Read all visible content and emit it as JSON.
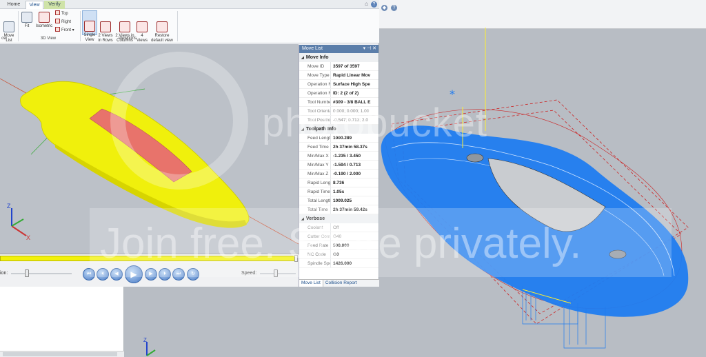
{
  "ribbon": {
    "tabs": [
      "Home",
      "View",
      "Verify"
    ],
    "buttons": {
      "move_list": "Move\nList",
      "fit": "Fit",
      "isometric": "Isometric",
      "top": "Top",
      "right": "Right",
      "front": "Front",
      "single_view": "Single\nView",
      "two_rows": "2 Views\nin Rows",
      "two_cols": "2 Views in\nColumns",
      "four_views": "4\nViews",
      "restore": "Restore\ndefault view"
    },
    "groups": {
      "left": "ow",
      "view3d": "3D View",
      "viewports": "Viewports"
    }
  },
  "move_list": {
    "title": "Move List",
    "sections": [
      {
        "name": "Move Info",
        "rows": [
          {
            "key": "Move ID",
            "value": "3597 of 3597"
          },
          {
            "key": "Move Type",
            "value": "Rapid Linear Mov"
          },
          {
            "key": "Operation Nar",
            "value": "Surface High Spe"
          },
          {
            "key": "Operation Nu",
            "value": "ID: 2 (2 of 2)"
          },
          {
            "key": "Tool Number",
            "value": "#309 - 3/8 BALL E"
          },
          {
            "key": "Tool Orientati",
            "value": "0.000; 0.000; 1.00"
          },
          {
            "key": "Tool Position",
            "value": "-0.547; 0.713; 2.0"
          }
        ]
      },
      {
        "name": "Toolpath Info",
        "rows": [
          {
            "key": "Feed Length",
            "value": "1000.289"
          },
          {
            "key": "Feed Time",
            "value": "2h 37min 58.37s"
          },
          {
            "key": "Min/Max X",
            "value": "-1.235 / 3.450"
          },
          {
            "key": "Min/Max Y",
            "value": "-1.594 / 0.713"
          },
          {
            "key": "Min/Max Z",
            "value": "-0.190 / 2.000"
          },
          {
            "key": "Rapid Length",
            "value": "8.736"
          },
          {
            "key": "Rapid Time",
            "value": "1.05s"
          },
          {
            "key": "Total Length",
            "value": "1009.025"
          },
          {
            "key": "Total Time",
            "value": "2h 37min 59.42s"
          }
        ]
      },
      {
        "name": "Verbose",
        "rows": [
          {
            "key": "Coolant",
            "value": "Off"
          },
          {
            "key": "Cutter Comp",
            "value": "G40"
          },
          {
            "key": "Feed Rate",
            "value": "500.000"
          },
          {
            "key": "NC Code",
            "value": "G0"
          },
          {
            "key": "Spindle Speec",
            "value": "1426.000"
          }
        ]
      }
    ],
    "bottom_tabs": [
      "Move List",
      "Collision Report"
    ]
  },
  "playback": {
    "position_label": "ion:",
    "speed_label": "Speed:",
    "progress": 0.99
  },
  "watermark": {
    "brand": "photobucket",
    "tagline": "Join free. Share privately."
  },
  "colors": {
    "part_yellow": "#f2f20a",
    "toolpath_blue": "#1f7cf0",
    "accent": "#5b7eaa"
  }
}
